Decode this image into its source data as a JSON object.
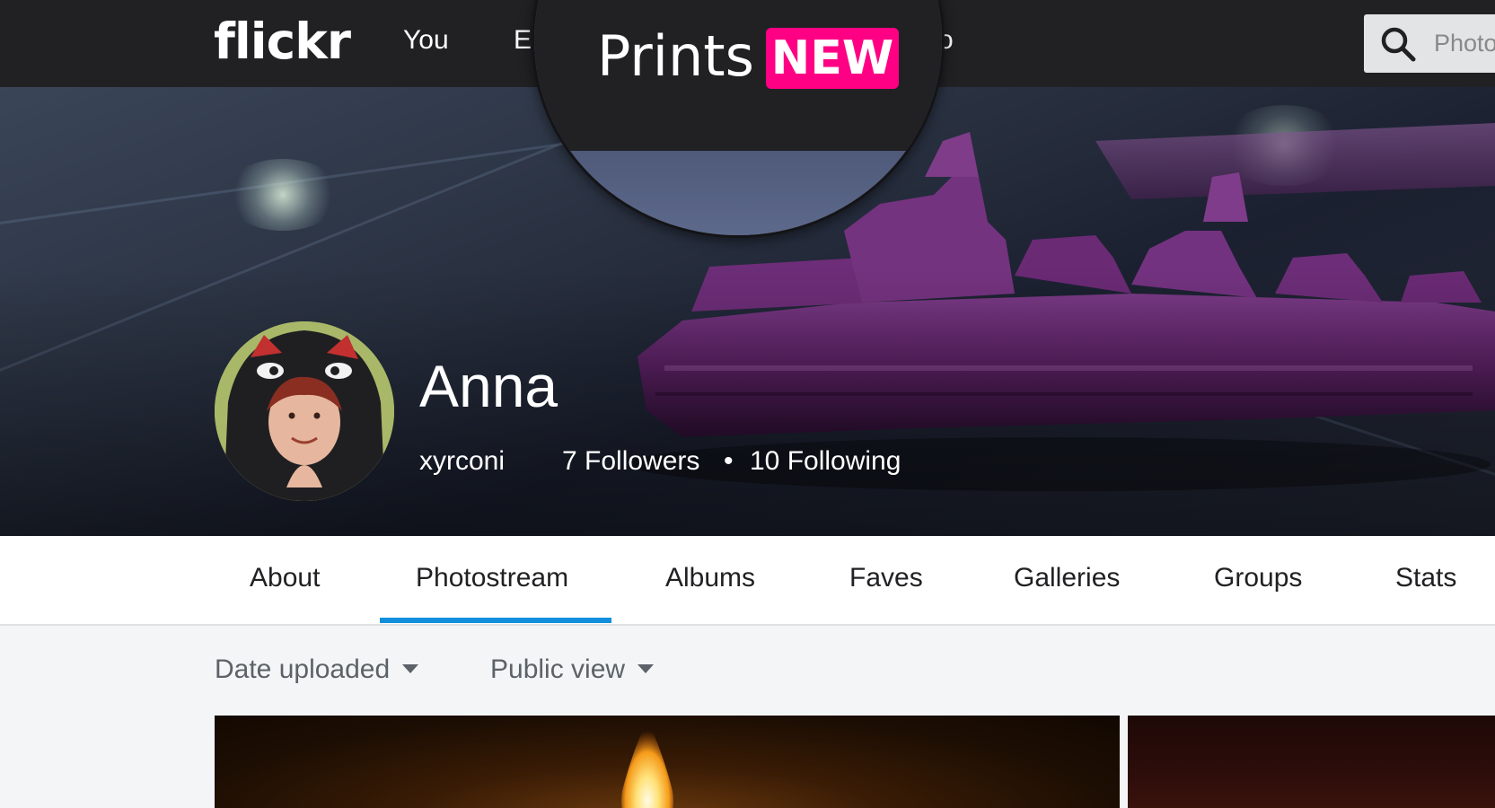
{
  "nav": {
    "logo": "flickr",
    "links": [
      "You",
      "Ex",
      "ro"
    ],
    "search_placeholder": "Photos"
  },
  "magnifier": {
    "label": "Prints",
    "badge": "NEW",
    "badge_color": "#ff0084"
  },
  "profile": {
    "name": "Anna",
    "handle": "xyrconi",
    "followers": "7 Followers",
    "separator": "•",
    "following": "10 Following"
  },
  "tabs": [
    "About",
    "Photostream",
    "Albums",
    "Faves",
    "Galleries",
    "Groups",
    "Stats"
  ],
  "active_tab": "Photostream",
  "accent_color": "#128fdc",
  "filters": {
    "sort": "Date uploaded",
    "view": "Public view"
  },
  "icons": {
    "search": "search-icon",
    "dropdown": "chevron-down-icon"
  }
}
